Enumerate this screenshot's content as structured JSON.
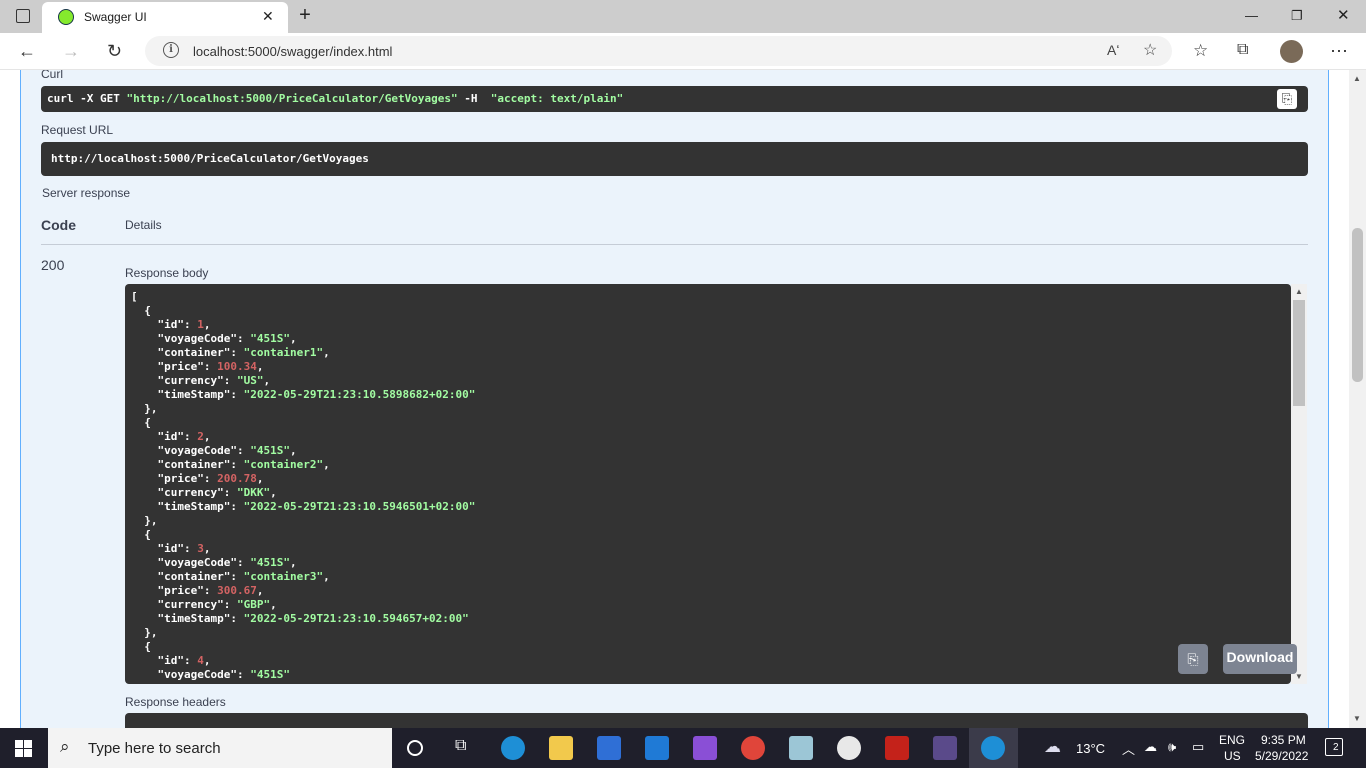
{
  "browser": {
    "tab_title": "Swagger UI",
    "url": "localhost:5000/swagger/index.html",
    "read_aloud_label": "Aʻ"
  },
  "curl": {
    "label": "Curl",
    "command_prefix": "curl -X GET ",
    "command_url": "\"http://localhost:5000/PriceCalculator/GetVoyages\"",
    "command_mid": " -H  ",
    "command_header": "\"accept: text/plain\""
  },
  "request_url": {
    "label": "Request URL",
    "value": "http://localhost:5000/PriceCalculator/GetVoyages"
  },
  "server_response": {
    "label": "Server response",
    "code_header": "Code",
    "details_header": "Details",
    "code": "200",
    "body_label": "Response body",
    "headers_label": "Response headers",
    "download_label": "Download",
    "items": [
      {
        "id": "1",
        "voyageCode": "\"451S\"",
        "container": "\"container1\"",
        "price": "100.34",
        "currency": "\"US\"",
        "timeStamp": "\"2022-05-29T21:23:10.5898682+02:00\""
      },
      {
        "id": "2",
        "voyageCode": "\"451S\"",
        "container": "\"container2\"",
        "price": "200.78",
        "currency": "\"DKK\"",
        "timeStamp": "\"2022-05-29T21:23:10.5946501+02:00\""
      },
      {
        "id": "3",
        "voyageCode": "\"451S\"",
        "container": "\"container3\"",
        "price": "300.67",
        "currency": "\"GBP\"",
        "timeStamp": "\"2022-05-29T21:23:10.594657+02:00\""
      },
      {
        "id": "4",
        "voyageCode": "\"451S\""
      }
    ]
  },
  "taskbar": {
    "search_placeholder": "Type here to search",
    "weather": "13°C",
    "lang1": "ENG",
    "lang2": "US",
    "time": "9:35 PM",
    "date": "5/29/2022",
    "notifications": "2"
  },
  "colors": {
    "swagger_border": "#61affe",
    "code_bg": "#333333",
    "string": "#a2fca2",
    "number": "#d36363"
  }
}
